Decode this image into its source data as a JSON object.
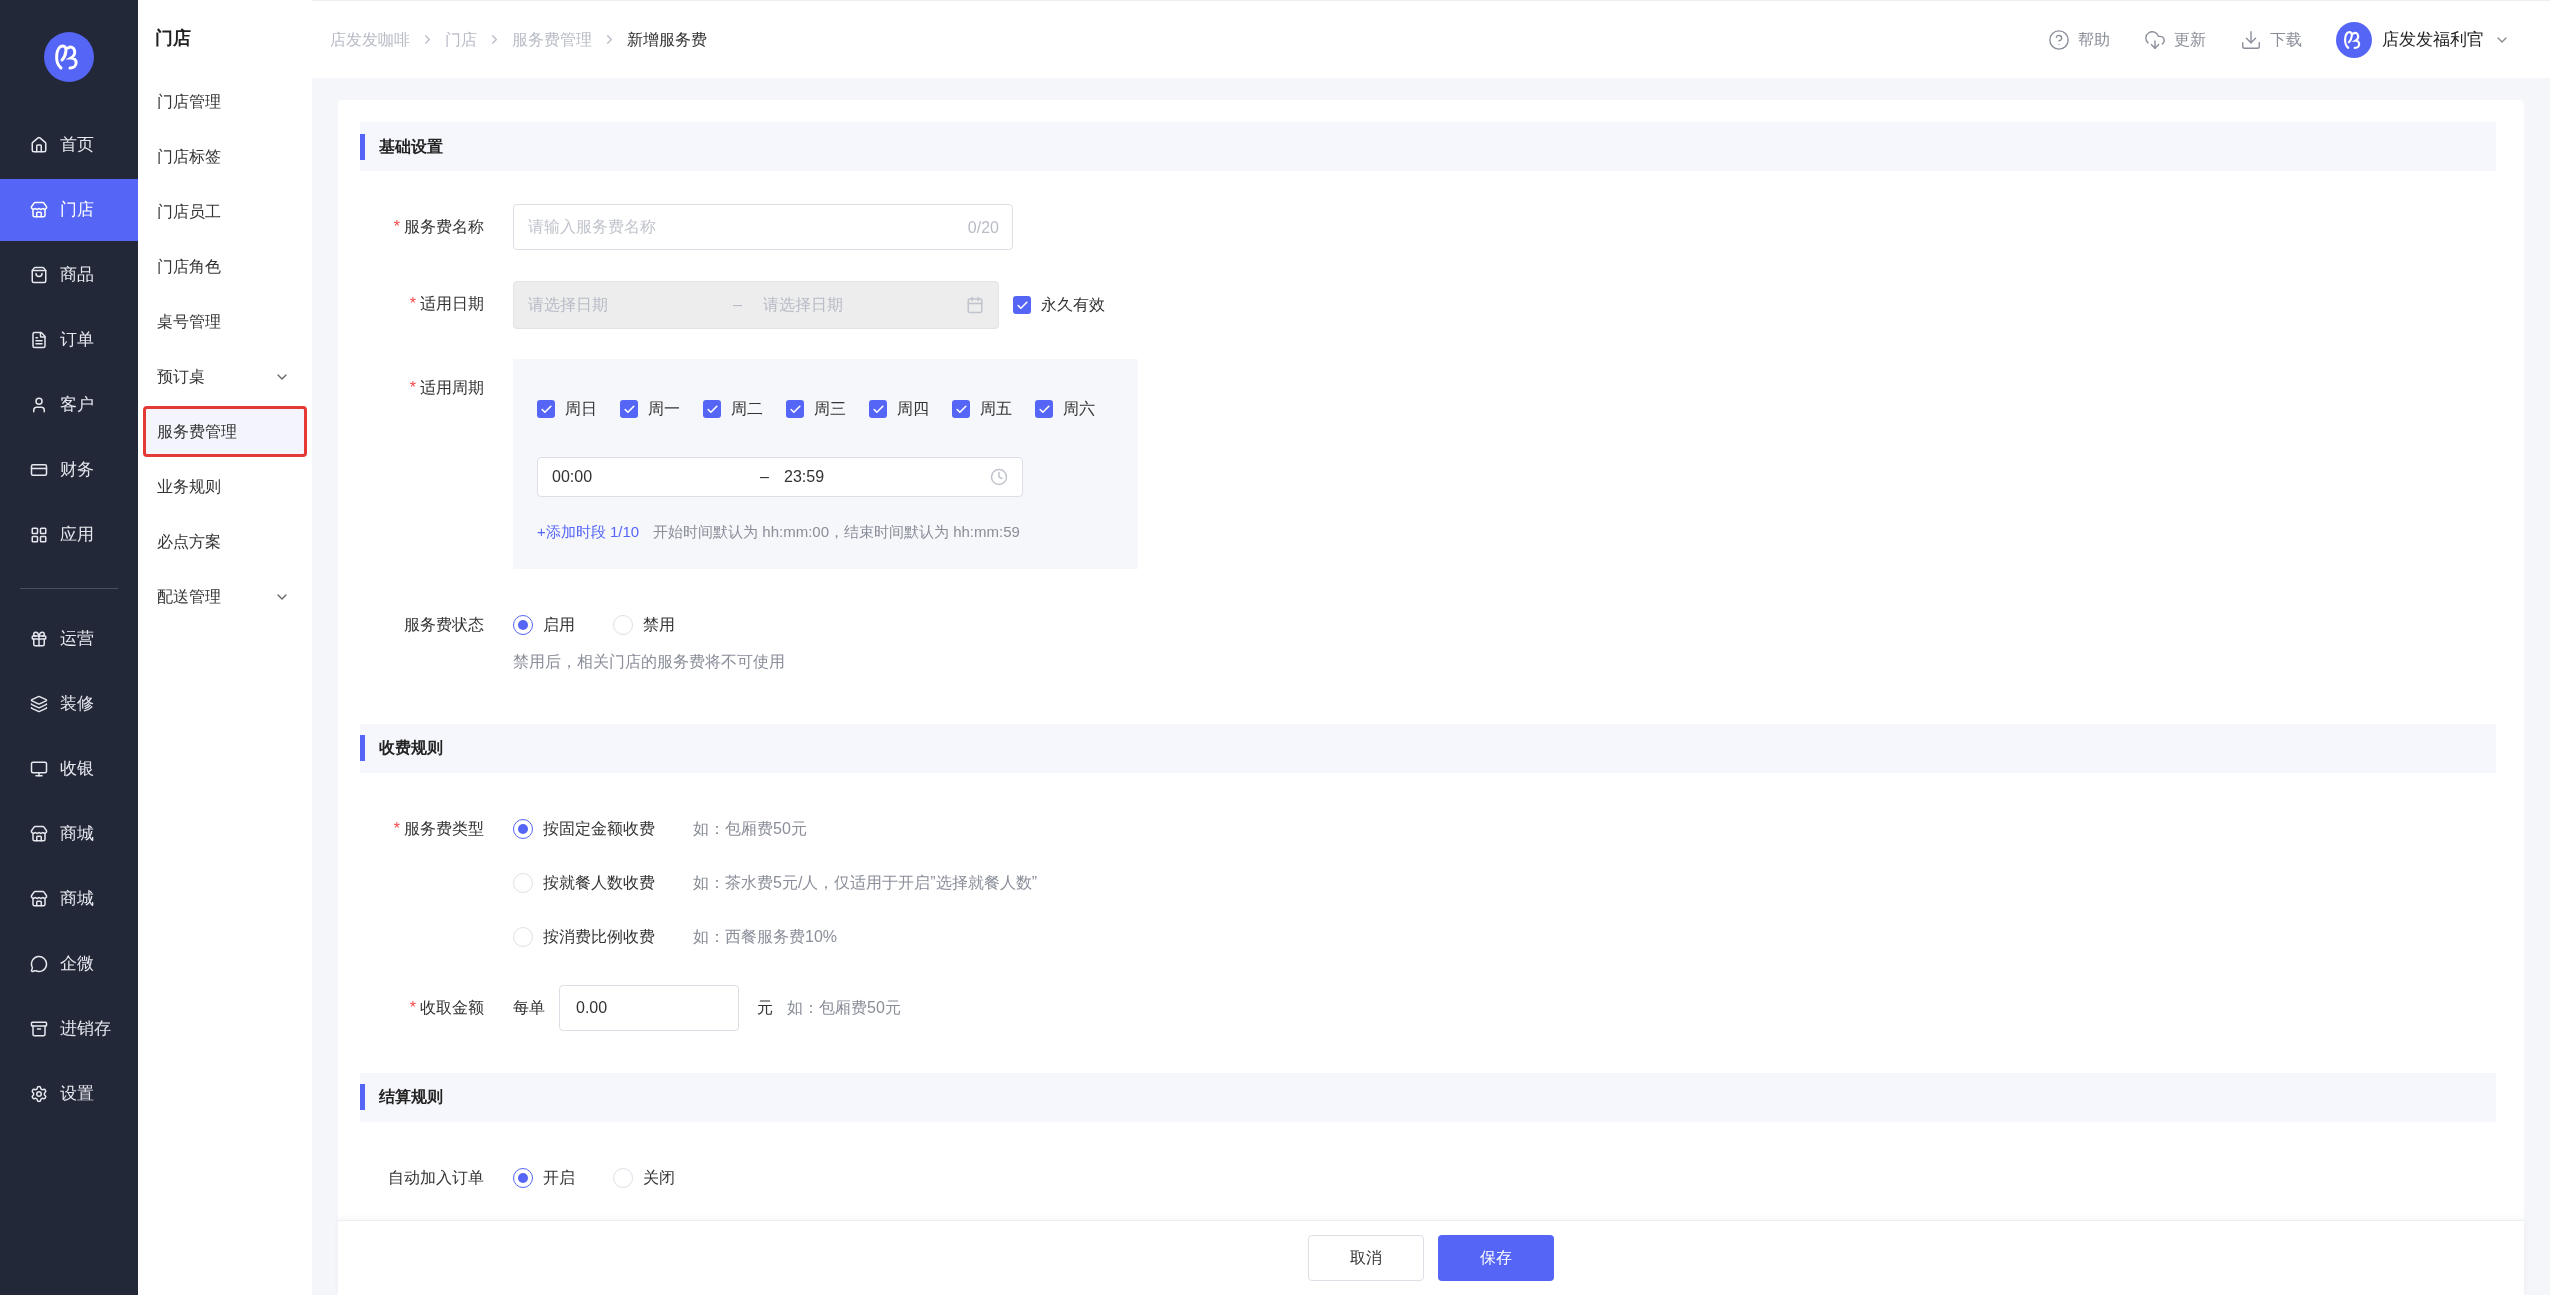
{
  "sidebar": {
    "groups": [
      [
        {
          "label": "首页",
          "selected": false
        },
        {
          "label": "门店",
          "selected": true
        },
        {
          "label": "商品",
          "selected": false
        },
        {
          "label": "订单",
          "selected": false
        },
        {
          "label": "客户",
          "selected": false
        },
        {
          "label": "财务",
          "selected": false
        },
        {
          "label": "应用",
          "selected": false
        }
      ],
      [
        {
          "label": "运营",
          "selected": false
        },
        {
          "label": "装修",
          "selected": false
        },
        {
          "label": "收银",
          "selected": false
        },
        {
          "label": "商城",
          "selected": false
        },
        {
          "label": "商城",
          "selected": false
        },
        {
          "label": "企微",
          "selected": false
        },
        {
          "label": "进销存",
          "selected": false
        },
        {
          "label": "设置",
          "selected": false
        }
      ]
    ]
  },
  "submenu": {
    "title": "门店",
    "items": [
      {
        "label": "门店管理",
        "expandable": false,
        "selected": false
      },
      {
        "label": "门店标签",
        "expandable": false,
        "selected": false
      },
      {
        "label": "门店员工",
        "expandable": false,
        "selected": false
      },
      {
        "label": "门店角色",
        "expandable": false,
        "selected": false
      },
      {
        "label": "桌号管理",
        "expandable": false,
        "selected": false
      },
      {
        "label": "预订桌",
        "expandable": true,
        "selected": false
      },
      {
        "label": "服务费管理",
        "expandable": false,
        "selected": true
      },
      {
        "label": "业务规则",
        "expandable": false,
        "selected": false
      },
      {
        "label": "必点方案",
        "expandable": false,
        "selected": false
      },
      {
        "label": "配送管理",
        "expandable": true,
        "selected": false
      }
    ]
  },
  "breadcrumb": [
    "店发发咖啡",
    "门店",
    "服务费管理",
    "新增服务费"
  ],
  "header_actions": [
    {
      "kind": "help",
      "label": "帮助"
    },
    {
      "kind": "update",
      "label": "更新"
    },
    {
      "kind": "download",
      "label": "下载"
    }
  ],
  "user": {
    "name": "店发发福利官"
  },
  "sections": [
    {
      "title": "基础设置",
      "fields": [
        {
          "kind": "text",
          "label": "服务费名称",
          "required_mark": "*",
          "placeholder": "请输入服务费名称",
          "counter": "0/20"
        },
        {
          "kind": "daterange",
          "label": "适用日期",
          "required_mark": "*",
          "disabled": true,
          "start_placeholder": "请选择日期",
          "separator": "–",
          "end_placeholder": "请选择日期",
          "checkbox": {
            "label": "永久有效",
            "checked": true
          }
        },
        {
          "kind": "weekly",
          "label": "适用周期",
          "required_mark": "*",
          "days": [
            {
              "label": "周日",
              "checked": true
            },
            {
              "label": "周一",
              "checked": true
            },
            {
              "label": "周二",
              "checked": true
            },
            {
              "label": "周三",
              "checked": true
            },
            {
              "label": "周四",
              "checked": true
            },
            {
              "label": "周五",
              "checked": true
            },
            {
              "label": "周六",
              "checked": true
            }
          ],
          "start_time": "00:00",
          "separator": "–",
          "end_time": "23:59",
          "add_link": "+添加时段 1/10",
          "hint": "开始时间默认为 hh:mm:00，结束时间默认为 hh:mm:59"
        },
        {
          "kind": "radio",
          "label": "服务费状态",
          "options": [
            {
              "label": "启用",
              "selected": true
            },
            {
              "label": "禁用",
              "selected": false
            }
          ],
          "hint": "禁用后，相关门店的服务费将不可使用"
        }
      ]
    },
    {
      "title": "收费规则",
      "fields": [
        {
          "kind": "radio_list",
          "label": "服务费类型",
          "required_mark": "*",
          "options": [
            {
              "label": "按固定金额收费",
              "example": "如：包厢费50元",
              "selected": true
            },
            {
              "label": "按就餐人数收费",
              "example": "如：茶水费5元/人，仅适用于开启”选择就餐人数”",
              "selected": false
            },
            {
              "label": "按消费比例收费",
              "example": "如：西餐服务费10%",
              "selected": false
            }
          ]
        },
        {
          "kind": "amount",
          "label": "收取金额",
          "required_mark": "*",
          "prefix": "每单",
          "value": "0.00",
          "suffix": "元",
          "example": "如：包厢费50元"
        }
      ]
    },
    {
      "title": "结算规则",
      "fields": [
        {
          "kind": "radio",
          "label": "自动加入订单",
          "options": [
            {
              "label": "开启",
              "selected": true
            },
            {
              "label": "关闭",
              "selected": false
            }
          ]
        }
      ]
    }
  ],
  "footer": {
    "buttons": [
      {
        "kind": "secondary",
        "label": "取消"
      },
      {
        "kind": "primary",
        "label": "保存"
      }
    ]
  }
}
